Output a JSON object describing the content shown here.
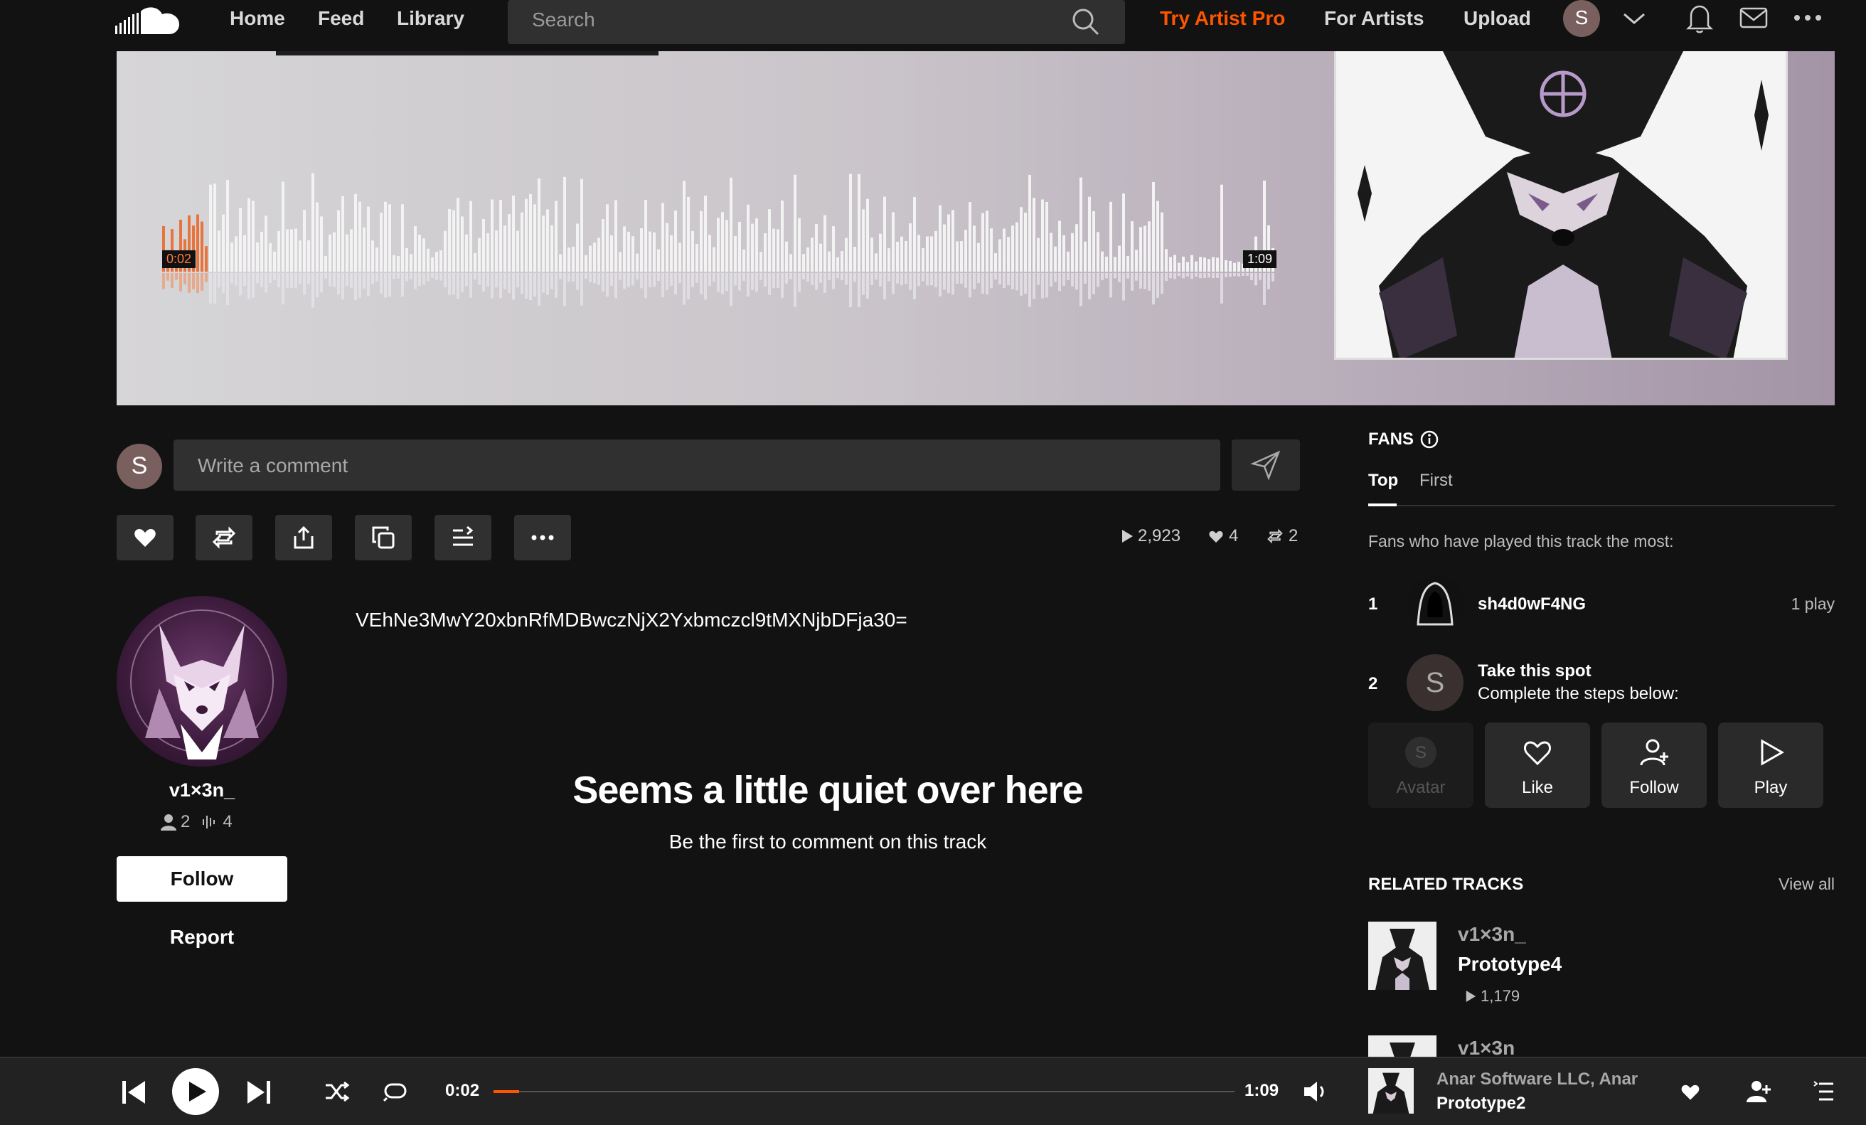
{
  "nav": {
    "home": "Home",
    "feed": "Feed",
    "library": "Library",
    "search_placeholder": "Search",
    "try_pro": "Try Artist Pro",
    "for_artists": "For Artists",
    "upload": "Upload",
    "avatar_letter": "S",
    "accent_color": "#ff5500"
  },
  "waveform": {
    "current_time": "0:02",
    "duration": "1:09"
  },
  "comment": {
    "avatar_letter": "S",
    "placeholder": "Write a comment"
  },
  "stats": {
    "plays": "2,923",
    "likes": "4",
    "reposts": "2"
  },
  "artist": {
    "name": "v1×3n_",
    "followers": "2",
    "tracks": "4",
    "follow_label": "Follow",
    "report_label": "Report"
  },
  "description": "VEhNe3MwY20xbnRfMDBwczNjX2Yxbmczcl9tMXNjbDFja30=",
  "empty_comments": {
    "title": "Seems a little quiet over here",
    "subtitle": "Be the first to comment on this track"
  },
  "fans": {
    "title": "FANS",
    "tab_top": "Top",
    "tab_first": "First",
    "description": "Fans who have played this track the most:",
    "list": [
      {
        "rank": "1",
        "name": "sh4d0wF4NG",
        "plays": "1 play"
      },
      {
        "rank": "2",
        "name": "Take this spot",
        "sub": "Complete the steps below:",
        "avatar_letter": "S"
      }
    ],
    "steps": [
      {
        "label": "Avatar",
        "letter": "S"
      },
      {
        "label": "Like"
      },
      {
        "label": "Follow"
      },
      {
        "label": "Play"
      }
    ]
  },
  "related": {
    "title": "RELATED TRACKS",
    "view_all": "View all",
    "tracks": [
      {
        "artist": "v1×3n_",
        "title": "Prototype4",
        "plays": "1,179"
      },
      {
        "artist": "v1×3n"
      }
    ]
  },
  "player": {
    "current_time": "0:02",
    "duration": "1:09",
    "progress": 0.035,
    "artist": "Anar Software LLC, Anar",
    "title": "Prototype2"
  }
}
